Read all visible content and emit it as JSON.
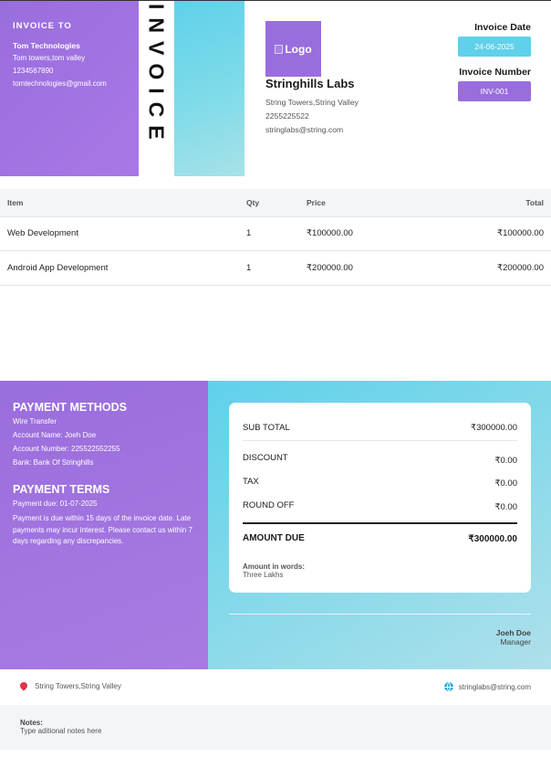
{
  "bill_to": {
    "heading": "INVOICE TO",
    "name": "Tom Technologies",
    "address": "Tom towers,tom valley",
    "phone": "1234567890",
    "email": "tomtechnologies@gmail.com"
  },
  "title": "INVOICE",
  "logo_alt": "Logo",
  "company": {
    "name": "Stringhills Labs",
    "address": "String Towers,String Valley",
    "phone": "2255225522",
    "email": "stringlabs@string.com"
  },
  "meta": {
    "date_label": "Invoice Date",
    "date_value": "24-06-2025",
    "number_label": "Invoice Number",
    "number_value": "INV-001"
  },
  "table": {
    "headers": [
      "Item",
      "Qty",
      "Price",
      "Total"
    ],
    "rows": [
      [
        "Web Development",
        "1",
        "₹100000.00",
        "₹100000.00"
      ],
      [
        "Android App Development",
        "1",
        "₹200000.00",
        "₹200000.00"
      ]
    ]
  },
  "payment": {
    "methods_heading": "PAYMENT METHODS",
    "method": "Wire Transfer",
    "account_name": "Account Name: Joeh Doe",
    "account_number": "Account Number: 225522552255",
    "bank": "Bank: Bank Of Stringhills",
    "terms_heading": "PAYMENT TERMS",
    "due": "Payment due: 01-07-2025",
    "note": "Payment is due within 15 days of the invoice date. Late payments may incur interest. Please contact us within 7 days regarding any discrepancies."
  },
  "totals": {
    "subtotal_label": "SUB TOTAL",
    "subtotal_value": "₹300000.00",
    "discount_label": "DISCOUNT",
    "discount_value": "₹0.00",
    "tax_label": "TAX",
    "tax_value": "₹0.00",
    "roundoff_label": "ROUND OFF",
    "roundoff_value": "₹0.00",
    "due_label": "AMOUNT DUE",
    "due_value": "₹300000.00",
    "words_label": "Amount in words:",
    "words_value": "Three Lakhs"
  },
  "signature": {
    "name": "Joeh Doe",
    "role": "Manager"
  },
  "footer": {
    "address": "String Towers,String Valley",
    "email": "stringlabs@string.com",
    "notes_label": "Notes:",
    "notes_text": "Type aditional notes here"
  },
  "colors": {
    "purple": "#9a6ddd",
    "cyan": "#5fd1ea"
  }
}
